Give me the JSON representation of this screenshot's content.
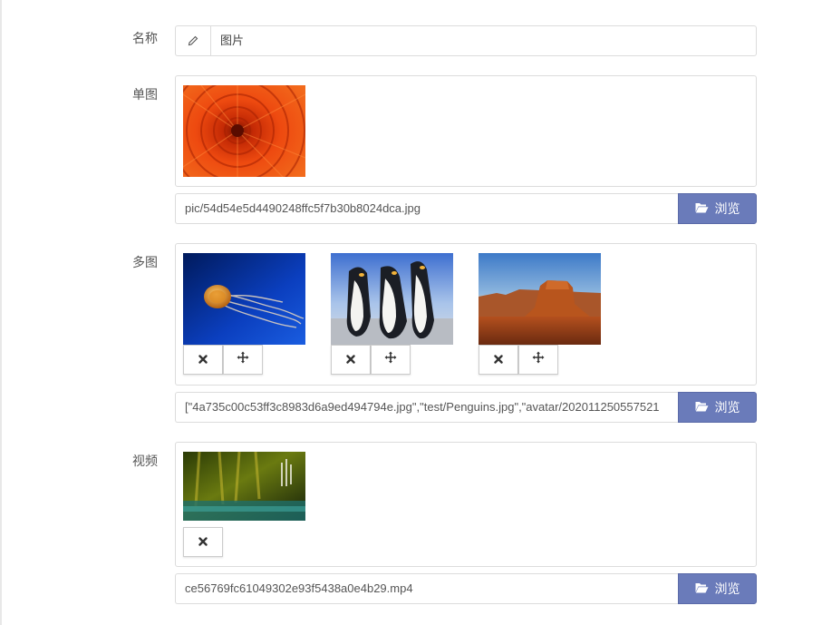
{
  "name_field": {
    "label": "名称",
    "value": "图片",
    "icon": "pencil-icon"
  },
  "single_image": {
    "label": "单图",
    "path": "pic/54d54e5d4490248ffc5f7b30b8024dca.jpg",
    "browse_label": "浏览"
  },
  "multi_image": {
    "label": "多图",
    "path": "[\"4a735c00c53ff3c8983d6a9ed494794e.jpg\",\"test/Penguins.jpg\",\"avatar/202011250557521",
    "browse_label": "浏览",
    "items": [
      "jellyfish",
      "penguins",
      "desert"
    ]
  },
  "video": {
    "label": "视频",
    "path": "ce56769fc61049302e93f5438a0e4b29.mp4",
    "browse_label": "浏览"
  },
  "colors": {
    "accent": "#6a7bba",
    "border": "#dcdcdc"
  }
}
